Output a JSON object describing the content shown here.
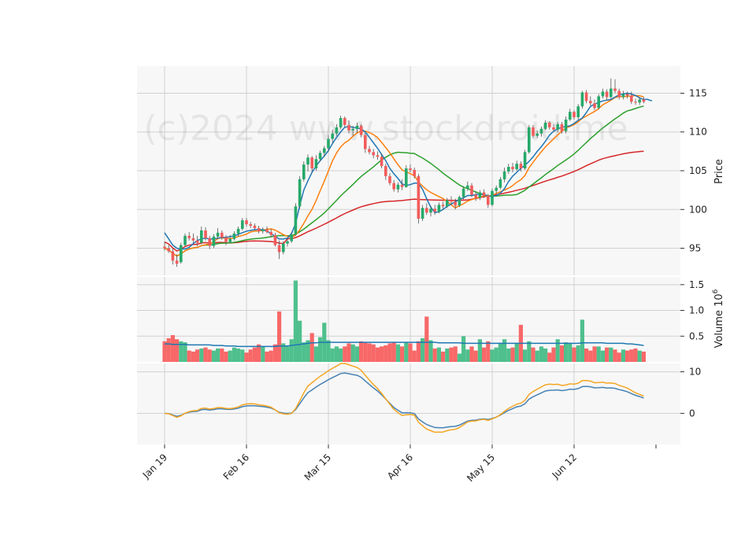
{
  "watermark": "(c)2024 www.stockdroid.me",
  "colors": {
    "up": "#26a969",
    "down": "#f25c5c",
    "volume_up": "#4fc08d",
    "volume_down": "#f86868",
    "ma5": "#1f77b4",
    "ma10": "#ff7f0e",
    "ma25": "#2ca02c",
    "ma75": "#d62728",
    "volume_ma": "#1f77b4",
    "osc1": "#4682b4",
    "osc2": "#f5a623",
    "panel_bg": "#f7f7f7",
    "grid": "#d0d0d0"
  },
  "chart_data": {
    "type": "candlestick",
    "x_tick_labels": [
      "Jan 19",
      "Feb 16",
      "Mar 15",
      "Apr 16",
      "May 15",
      "Jun 12"
    ],
    "x_tick_index": [
      0,
      20,
      40,
      60,
      80,
      100
    ],
    "price_panel": {
      "ylabel": "Price",
      "ylim": [
        91.5,
        118.5
      ],
      "yticks": [
        95,
        100,
        105,
        110,
        115
      ],
      "ohlc": [
        [
          95.2,
          95.8,
          94.7,
          95.0
        ],
        [
          95.0,
          95.4,
          94.4,
          94.6
        ],
        [
          94.6,
          95.0,
          92.9,
          93.4
        ],
        [
          93.4,
          94.2,
          92.6,
          93.0
        ],
        [
          93.2,
          95.7,
          93.0,
          95.4
        ],
        [
          95.4,
          96.9,
          95.2,
          96.6
        ],
        [
          96.6,
          97.1,
          96.0,
          96.3
        ],
        [
          96.3,
          96.9,
          95.7,
          96.0
        ],
        [
          96.0,
          96.6,
          95.3,
          95.7
        ],
        [
          95.7,
          97.8,
          95.5,
          97.3
        ],
        [
          97.3,
          97.7,
          96.0,
          96.3
        ],
        [
          96.3,
          96.6,
          94.9,
          95.3
        ],
        [
          95.3,
          96.8,
          95.0,
          96.5
        ],
        [
          96.5,
          97.6,
          96.3,
          97.0
        ],
        [
          97.0,
          97.3,
          96.1,
          96.4
        ],
        [
          96.4,
          96.7,
          95.4,
          95.8
        ],
        [
          95.8,
          96.7,
          95.6,
          96.2
        ],
        [
          96.2,
          97.2,
          96.0,
          96.9
        ],
        [
          96.9,
          97.8,
          96.5,
          97.5
        ],
        [
          97.5,
          98.9,
          97.3,
          98.6
        ],
        [
          98.6,
          98.9,
          97.8,
          98.1
        ],
        [
          98.1,
          98.4,
          97.6,
          97.9
        ],
        [
          97.9,
          98.2,
          97.3,
          97.6
        ],
        [
          97.6,
          97.9,
          96.9,
          97.2
        ],
        [
          97.2,
          97.7,
          96.9,
          97.4
        ],
        [
          97.4,
          97.8,
          96.9,
          97.1
        ],
        [
          97.1,
          97.5,
          96.4,
          96.7
        ],
        [
          96.7,
          97.0,
          95.2,
          95.4
        ],
        [
          95.4,
          96.0,
          93.6,
          94.5
        ],
        [
          94.5,
          95.9,
          94.2,
          95.6
        ],
        [
          95.6,
          96.3,
          95.2,
          95.9
        ],
        [
          95.9,
          97.1,
          95.7,
          96.8
        ],
        [
          96.8,
          100.8,
          96.6,
          100.4
        ],
        [
          100.4,
          104.3,
          100.1,
          103.9
        ],
        [
          103.9,
          106.2,
          103.6,
          105.8
        ],
        [
          105.8,
          107.1,
          104.9,
          106.7
        ],
        [
          106.7,
          106.9,
          104.8,
          105.3
        ],
        [
          105.3,
          107.0,
          105.0,
          106.5
        ],
        [
          106.5,
          107.6,
          106.2,
          107.3
        ],
        [
          107.3,
          108.2,
          106.8,
          107.9
        ],
        [
          107.9,
          109.6,
          107.4,
          109.1
        ],
        [
          109.1,
          110.3,
          108.6,
          109.8
        ],
        [
          109.8,
          111.0,
          109.5,
          110.6
        ],
        [
          110.6,
          112.1,
          110.4,
          111.8
        ],
        [
          111.8,
          112.0,
          110.6,
          110.9
        ],
        [
          110.9,
          111.5,
          109.8,
          110.2
        ],
        [
          110.2,
          110.8,
          109.5,
          110.4
        ],
        [
          110.4,
          111.2,
          109.9,
          110.8
        ],
        [
          110.8,
          111.0,
          109.3,
          109.6
        ],
        [
          109.6,
          109.9,
          107.3,
          107.8
        ],
        [
          107.8,
          108.2,
          107.1,
          107.4
        ],
        [
          107.4,
          107.8,
          106.6,
          107.0
        ],
        [
          107.0,
          107.5,
          106.4,
          106.8
        ],
        [
          106.8,
          107.2,
          105.3,
          105.6
        ],
        [
          105.6,
          105.9,
          103.8,
          104.3
        ],
        [
          104.3,
          104.7,
          103.1,
          103.4
        ],
        [
          103.4,
          103.8,
          102.3,
          102.6
        ],
        [
          102.6,
          103.5,
          102.2,
          103.2
        ],
        [
          103.2,
          103.9,
          102.5,
          102.9
        ],
        [
          102.9,
          105.7,
          102.8,
          105.3
        ],
        [
          105.3,
          105.8,
          104.8,
          105.1
        ],
        [
          105.1,
          105.4,
          104.0,
          104.3
        ],
        [
          104.3,
          104.6,
          98.2,
          98.8
        ],
        [
          98.8,
          100.6,
          98.5,
          100.2
        ],
        [
          100.2,
          100.8,
          99.3,
          99.6
        ],
        [
          99.6,
          100.5,
          99.1,
          100.1
        ],
        [
          100.1,
          100.6,
          99.3,
          99.7
        ],
        [
          99.7,
          100.9,
          99.5,
          100.6
        ],
        [
          100.6,
          101.0,
          100.0,
          100.4
        ],
        [
          100.4,
          101.5,
          100.2,
          101.2
        ],
        [
          101.2,
          101.7,
          100.6,
          101.0
        ],
        [
          101.0,
          101.4,
          100.0,
          100.5
        ],
        [
          100.5,
          101.8,
          100.3,
          101.6
        ],
        [
          101.6,
          103.0,
          101.3,
          102.7
        ],
        [
          102.7,
          103.6,
          102.4,
          103.1
        ],
        [
          103.1,
          103.4,
          101.6,
          101.9
        ],
        [
          101.9,
          102.3,
          101.1,
          101.5
        ],
        [
          101.5,
          102.5,
          101.2,
          102.2
        ],
        [
          102.2,
          102.6,
          101.5,
          101.8
        ],
        [
          101.8,
          102.0,
          100.2,
          100.6
        ],
        [
          100.6,
          102.7,
          100.4,
          102.4
        ],
        [
          102.4,
          103.1,
          102.0,
          102.8
        ],
        [
          102.8,
          104.2,
          102.6,
          103.9
        ],
        [
          103.9,
          105.4,
          103.5,
          104.9
        ],
        [
          104.9,
          105.9,
          104.6,
          105.5
        ],
        [
          105.5,
          106.0,
          104.8,
          105.2
        ],
        [
          105.2,
          106.3,
          105.0,
          105.9
        ],
        [
          105.9,
          106.2,
          104.9,
          105.3
        ],
        [
          105.3,
          107.7,
          105.1,
          107.4
        ],
        [
          107.4,
          110.9,
          107.2,
          110.6
        ],
        [
          110.6,
          110.9,
          109.2,
          109.5
        ],
        [
          109.5,
          110.2,
          109.2,
          109.8
        ],
        [
          109.8,
          110.7,
          109.4,
          110.4
        ],
        [
          110.4,
          111.5,
          110.2,
          111.2
        ],
        [
          111.2,
          111.4,
          110.3,
          110.6
        ],
        [
          110.6,
          111.0,
          110.0,
          110.3
        ],
        [
          110.3,
          111.3,
          110.0,
          111.0
        ],
        [
          111.0,
          111.3,
          109.8,
          110.1
        ],
        [
          110.1,
          112.0,
          109.8,
          111.6
        ],
        [
          111.6,
          113.0,
          111.4,
          112.6
        ],
        [
          112.6,
          112.8,
          111.6,
          111.9
        ],
        [
          111.9,
          113.6,
          111.6,
          113.3
        ],
        [
          113.3,
          115.3,
          113.0,
          115.1
        ],
        [
          115.1,
          115.4,
          113.7,
          114.0
        ],
        [
          114.0,
          114.6,
          113.4,
          113.7
        ],
        [
          113.7,
          114.2,
          112.8,
          113.1
        ],
        [
          113.1,
          114.9,
          112.9,
          114.6
        ],
        [
          114.6,
          115.6,
          114.3,
          115.2
        ],
        [
          115.2,
          115.5,
          114.1,
          114.5
        ],
        [
          114.5,
          116.9,
          114.3,
          115.6
        ],
        [
          115.6,
          116.8,
          115.0,
          115.3
        ],
        [
          115.3,
          115.6,
          114.2,
          114.5
        ],
        [
          114.5,
          115.3,
          114.2,
          114.9
        ],
        [
          114.9,
          115.2,
          114.3,
          114.7
        ],
        [
          114.7,
          115.2,
          113.6,
          113.9
        ],
        [
          113.9,
          114.3,
          113.5,
          113.8
        ],
        [
          113.8,
          114.5,
          113.5,
          114.2
        ],
        [
          114.2,
          114.5,
          113.7,
          113.9
        ]
      ],
      "ma5": [
        97.0,
        96.2,
        95.4,
        95.0,
        94.9,
        94.9,
        95.1,
        95.6,
        96.0,
        96.2,
        96.3,
        96.2,
        96.2,
        96.3,
        96.4,
        96.4,
        96.5,
        96.6,
        96.8,
        97.0,
        97.2,
        97.3,
        97.4,
        97.4,
        97.4,
        97.2,
        96.9,
        96.5,
        96.2,
        96.2,
        96.3,
        96.9,
        98.2,
        100.5,
        102.5,
        103.7,
        104.8,
        105.6,
        106.3,
        106.9,
        107.6,
        108.5,
        109.3,
        110.0,
        110.6,
        110.7,
        110.6,
        110.5,
        110.4,
        110.0,
        109.3,
        108.6,
        107.9,
        107.1,
        106.3,
        105.3,
        104.6,
        104.0,
        103.3,
        103.1,
        103.2,
        103.4,
        103.4,
        102.6,
        101.4,
        100.3,
        99.6,
        99.7,
        100.0,
        100.4,
        100.7,
        101.0,
        101.3,
        101.5,
        101.8,
        101.8,
        101.9,
        102.0,
        101.9,
        101.7,
        101.7,
        101.8,
        102.1,
        102.7,
        103.6,
        104.3,
        104.8,
        105.3,
        105.7,
        106.2,
        106.8,
        107.5,
        108.1,
        108.8,
        109.6,
        110.1,
        110.4,
        110.6,
        110.7,
        110.8,
        111.1,
        111.5,
        111.8,
        112.5,
        113.3,
        113.6,
        113.8,
        114.0,
        114.1,
        114.2,
        114.5,
        114.8,
        114.9,
        115.0,
        114.9,
        114.7,
        114.4,
        114.2,
        114.2,
        114.0
      ]
    },
    "volume_panel": {
      "ylabel": "Volume  10^6",
      "ylim": [
        0,
        1.65
      ],
      "yticks": [
        "0.5",
        "1.0",
        "1.5"
      ],
      "values": [
        0.4,
        0.46,
        0.52,
        0.44,
        0.4,
        0.38,
        0.22,
        0.2,
        0.24,
        0.26,
        0.28,
        0.24,
        0.22,
        0.26,
        0.26,
        0.2,
        0.22,
        0.28,
        0.26,
        0.24,
        0.18,
        0.24,
        0.28,
        0.34,
        0.3,
        0.2,
        0.22,
        0.34,
        0.98,
        0.36,
        0.3,
        0.44,
        1.58,
        0.8,
        0.38,
        0.42,
        0.56,
        0.3,
        0.48,
        0.76,
        0.42,
        0.26,
        0.3,
        0.26,
        0.3,
        0.36,
        0.34,
        0.3,
        0.4,
        0.38,
        0.36,
        0.34,
        0.28,
        0.3,
        0.32,
        0.36,
        0.38,
        0.34,
        0.3,
        0.38,
        0.36,
        0.22,
        0.4,
        0.46,
        0.88,
        0.42,
        0.26,
        0.28,
        0.2,
        0.26,
        0.28,
        0.3,
        0.16,
        0.5,
        0.24,
        0.3,
        0.22,
        0.44,
        0.28,
        0.4,
        0.24,
        0.28,
        0.36,
        0.44,
        0.26,
        0.28,
        0.36,
        0.72,
        0.24,
        0.4,
        0.28,
        0.22,
        0.3,
        0.26,
        0.18,
        0.28,
        0.44,
        0.32,
        0.38,
        0.36,
        0.28,
        0.32,
        0.82,
        0.26,
        0.22,
        0.3,
        0.3,
        0.22,
        0.28,
        0.28,
        0.24,
        0.18,
        0.24,
        0.22,
        0.24,
        0.26,
        0.22,
        0.2
      ],
      "ma": [
        0.35,
        0.35,
        0.34,
        0.34,
        0.34,
        0.34,
        0.33,
        0.33,
        0.33,
        0.33,
        0.33,
        0.33,
        0.32,
        0.32,
        0.32,
        0.31,
        0.31,
        0.31,
        0.3,
        0.3,
        0.3,
        0.3,
        0.3,
        0.3,
        0.3,
        0.3,
        0.3,
        0.3,
        0.31,
        0.31,
        0.31,
        0.32,
        0.33,
        0.34,
        0.35,
        0.36,
        0.37,
        0.37,
        0.38,
        0.38,
        0.38,
        0.38,
        0.38,
        0.38,
        0.38,
        0.38,
        0.38,
        0.38,
        0.38,
        0.38,
        0.38,
        0.38,
        0.38,
        0.38,
        0.38,
        0.38,
        0.38,
        0.38,
        0.38,
        0.38,
        0.38,
        0.38,
        0.38,
        0.38,
        0.38,
        0.38,
        0.38,
        0.37,
        0.37,
        0.37,
        0.37,
        0.37,
        0.37,
        0.36,
        0.36,
        0.36,
        0.36,
        0.36,
        0.36,
        0.36,
        0.36,
        0.36,
        0.36,
        0.36,
        0.36,
        0.36,
        0.36,
        0.36,
        0.36,
        0.36,
        0.36,
        0.36,
        0.36,
        0.36,
        0.36,
        0.36,
        0.36,
        0.36,
        0.36,
        0.36,
        0.36,
        0.36,
        0.37,
        0.37,
        0.37,
        0.37,
        0.37,
        0.37,
        0.36,
        0.36,
        0.36,
        0.36,
        0.36,
        0.35,
        0.35,
        0.34,
        0.33,
        0.32
      ]
    },
    "oscillator_panel": {
      "ylim": [
        -7.5,
        12
      ],
      "yticks": [
        "0",
        "10"
      ]
    }
  }
}
